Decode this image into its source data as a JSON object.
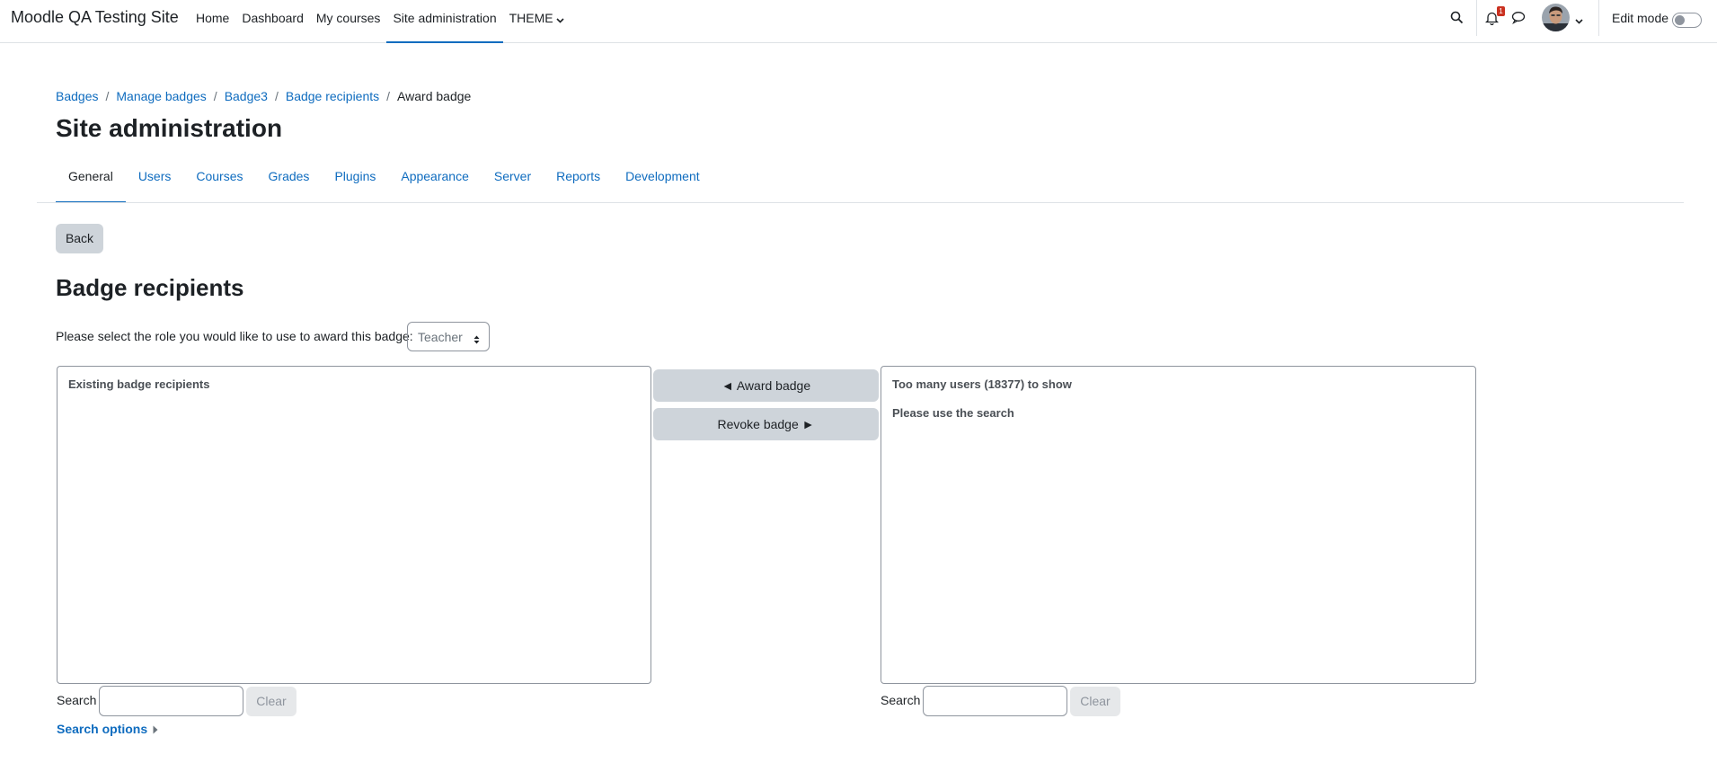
{
  "site": {
    "brand": "Moodle QA Testing Site"
  },
  "primary_nav": {
    "items": [
      {
        "label": "Home",
        "active": false
      },
      {
        "label": "Dashboard",
        "active": false
      },
      {
        "label": "My courses",
        "active": false
      },
      {
        "label": "Site administration",
        "active": true
      },
      {
        "label": "THEME",
        "active": false,
        "dropdown": true
      }
    ]
  },
  "user_menu": {
    "search_icon": "search-icon",
    "notification_icon": "bell-icon",
    "notification_count": "1",
    "messages_icon": "chat-bubble-icon",
    "edit_mode_label": "Edit mode",
    "edit_mode_on": false
  },
  "breadcrumb": {
    "items": [
      "Badges",
      "Manage badges",
      "Badge3",
      "Badge recipients"
    ],
    "current": "Award badge"
  },
  "page": {
    "heading": "Site administration",
    "section_heading": "Badge recipients",
    "back_label": "Back",
    "role_prompt": "Please select the role you would like to use to award this badge:",
    "role_selected": "Teacher"
  },
  "secondary_nav": {
    "items": [
      {
        "label": "General",
        "active": true
      },
      {
        "label": "Users",
        "active": false
      },
      {
        "label": "Courses",
        "active": false
      },
      {
        "label": "Grades",
        "active": false
      },
      {
        "label": "Plugins",
        "active": false
      },
      {
        "label": "Appearance",
        "active": false
      },
      {
        "label": "Server",
        "active": false
      },
      {
        "label": "Reports",
        "active": false
      },
      {
        "label": "Development",
        "active": false
      }
    ]
  },
  "recipients": {
    "existing_group": "Existing badge recipients",
    "potential_group_1": "Too many users (18377) to show",
    "potential_group_2": "Please use the search",
    "award_label": "◄ Award badge",
    "revoke_label": "Revoke badge ►",
    "search_label": "Search",
    "clear_label": "Clear",
    "search_value_left": "",
    "search_value_right": "",
    "search_options_label": "Search options"
  },
  "colors": {
    "link": "#0f6cbf",
    "text": "#1d2125",
    "button_bg": "#ced4da",
    "notification_badge": "#ca3120"
  }
}
